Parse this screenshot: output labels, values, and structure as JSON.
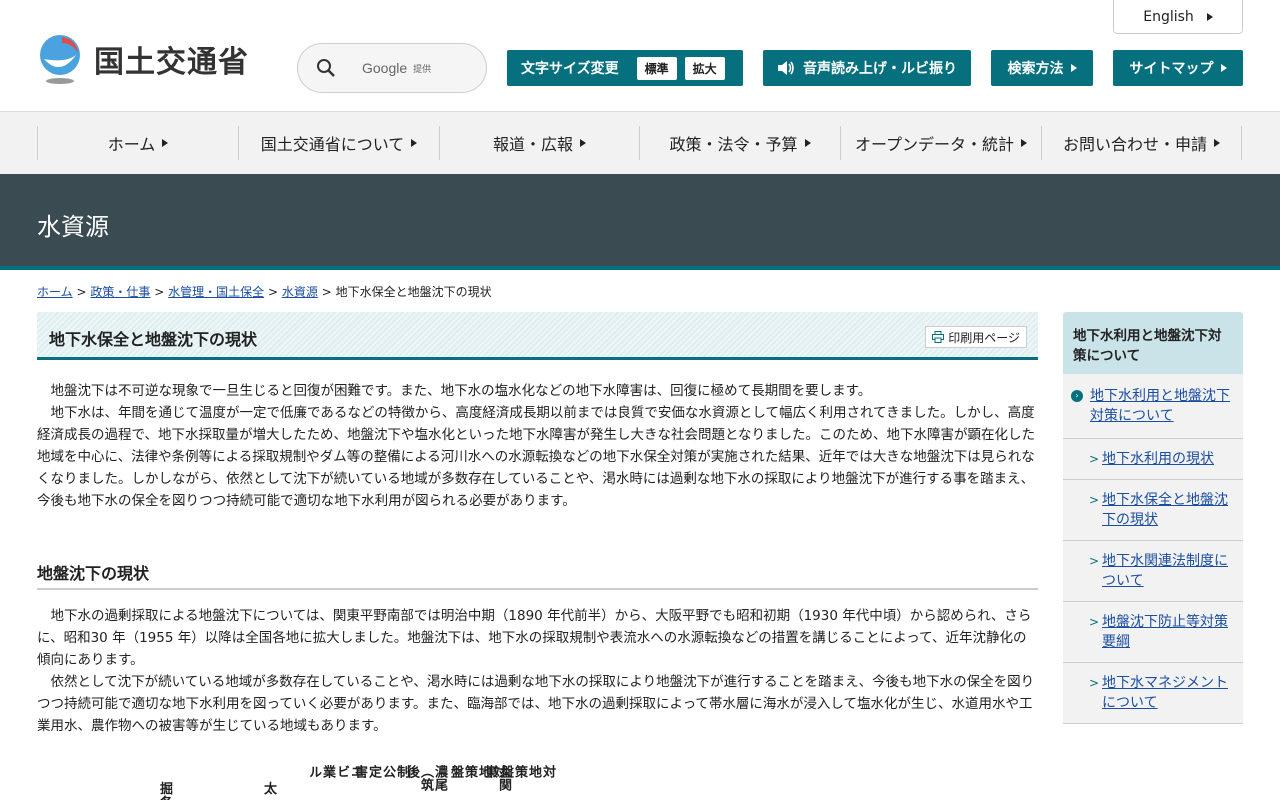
{
  "header": {
    "site_name": "国土交通省",
    "english_label": "English",
    "search": {
      "brand": "Google",
      "provided": "提供"
    },
    "fontsize": {
      "label": "文字サイズ変更",
      "normal": "標準",
      "large": "拡大"
    },
    "voice_label": "音声読み上げ・ルビ振り",
    "howto_label": "検索方法",
    "sitemap_label": "サイトマップ"
  },
  "nav": {
    "items": [
      "ホーム",
      "国土交通省について",
      "報道・広報",
      "政策・法令・予算",
      "オープンデータ・統計",
      "お問い合わせ・申請"
    ]
  },
  "banner": {
    "title": "水資源"
  },
  "breadcrumb": {
    "links": [
      "ホーム",
      "政策・仕事",
      "水管理・国土保全",
      "水資源"
    ],
    "separator": ">",
    "current": "地下水保全と地盤沈下の現状"
  },
  "main": {
    "title": "地下水保全と地盤沈下の現状",
    "print_label": "印刷用ページ",
    "intro": [
      "地盤沈下は不可逆な現象で一旦生じると回復が困難です。また、地下水の塩水化などの地下水障害は、回復に極めて長期間を要します。",
      "地下水は、年間を通じて温度が一定で低廉であるなどの特徴から、高度経済成長期以前までは良質で安価な水資源として幅広く利用されてきました。しかし、高度経済成長の過程で、地下水採取量が増大したため、地盤沈下や塩水化といった地下水障害が発生し大きな社会問題となりました。このため、地下水障害が顕在化した地域を中心に、法律や条例等による採取規制やダム等の整備による河川水への水源転換などの地下水保全対策が実施された結果、近年では大きな地盤沈下は見られなくなりました。しかしながら、依然として沈下が続いている地域が多数存在していることや、渇水時には過剰な地下水の採取により地盤沈下が進行する事を踏まえ、今後も地下水の保全を図りつつ持続可能で適切な地下水利用が図られる必要があります。"
    ],
    "section_heading": "地盤沈下の現状",
    "section_body": [
      "地下水の過剰採取による地盤沈下については、関東平野南部では明治中期（1890 年代前半）から、大阪平野でも昭和初期（1930 年代中頃）から認められ、さらに、昭和30 年（1955 年）以降は全国各地に拡大しました。地盤沈下は、地下水の採取規制や表流水への水源転換などの措置を講じることによって、近年沈静化の傾向にあります。",
      "依然として沈下が続いている地域が多数存在していることや、渇水時には過剰な地下水の採取により地盤沈下が進行することを踏まえ、今後も地下水の保全を図りつつ持続可能で適切な地下水利用を図っていく必要があります。また、臨海部では、地下水の過剰採取によって帯水層に海水が浸入して塩水化が生じ、水道用水や工業用水、農作物への被害等が生じている地域もあります。"
    ],
    "figure_fragments": [
      "掘各関",
      "太",
      "エビ業ル",
      "制公定害",
      "濃尾（筑後",
      "対地策盤",
      "（関東",
      "対地策盤"
    ]
  },
  "side": {
    "heading": "地下水利用と地盤沈下対策について",
    "current": "地下水利用と地盤沈下対策について",
    "items": [
      "地下水利用の現状",
      "地下水保全と地盤沈下の現状",
      "地下水関連法制度について",
      "地盤沈下防止等対策要綱",
      "地下水マネジメントについて"
    ]
  }
}
